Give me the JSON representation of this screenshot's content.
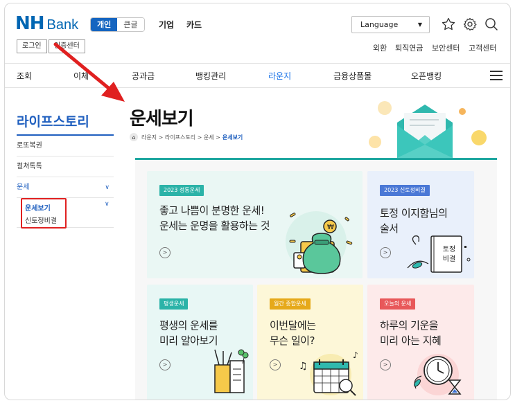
{
  "header": {
    "logo_nh": "NH",
    "logo_bank": "Bank",
    "toggle_personal": "개인",
    "toggle_large": "큰글",
    "business": "기업",
    "card": "카드",
    "language": "Language",
    "login": "로그인",
    "cert_center": "인증센터",
    "util_links": [
      "외환",
      "퇴직연금",
      "보안센터",
      "고객센터"
    ]
  },
  "gnb": [
    "조회",
    "이체",
    "공과금",
    "뱅킹관리",
    "라운지",
    "금융상품몰",
    "오픈뱅킹"
  ],
  "sidebar": {
    "title": "라이프스토리",
    "items": [
      "로또복권",
      "컬쳐톡톡",
      "운세"
    ],
    "sub_active": "운세보기",
    "sub_other": "신토정비결"
  },
  "page": {
    "title": "운세보기",
    "breadcrumb": [
      "라운지",
      "라이프스토리",
      "운세"
    ],
    "breadcrumb_current": "운세보기"
  },
  "tiles": [
    {
      "tag": "2023 정통운세",
      "title": "좋고 나쁨이 분명한 운세!\n운세는 운명을 활용하는 것",
      "bg": "#eaf7f4",
      "tag_color": "#2bb3a8"
    },
    {
      "tag": "2023 신토정비결",
      "title": "토정 이지함님의\n술서",
      "bg": "#e9f0fb",
      "tag_color": "#4a78d6",
      "book_label": "토정\n비결"
    },
    {
      "tag": "평생운세",
      "title": "평생의 운세를\n미리 알아보기",
      "bg": "#e8f7f5",
      "tag_color": "#2bb3a8"
    },
    {
      "tag": "월간 종합운세",
      "title": "이번달에는\n무슨 일이?",
      "bg": "#fdf7d8",
      "tag_color": "#e6a91a"
    },
    {
      "tag": "오늘의 운세",
      "title": "하루의 기운을\n미리 아는 지혜",
      "bg": "#fdeaea",
      "tag_color": "#e8585a"
    }
  ],
  "colors": {
    "brand": "#0066b3",
    "accent": "#1f5fbf",
    "teal": "#1ea6a0",
    "annotation_red": "#e02020"
  }
}
